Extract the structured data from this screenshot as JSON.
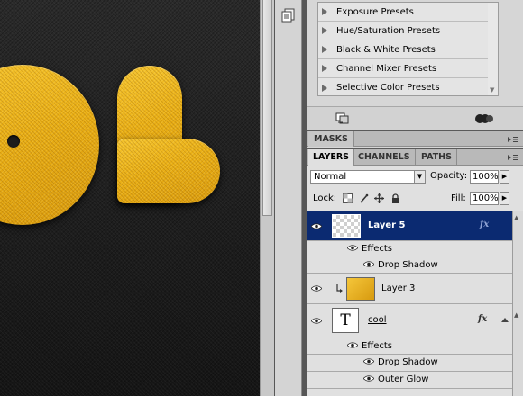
{
  "adjustments": {
    "presets": [
      "Exposure Presets",
      "Hue/Saturation Presets",
      "Black & White Presets",
      "Channel Mixer Presets",
      "Selective Color Presets"
    ],
    "icons": [
      "return-to-list-icon",
      "clip-to-layer-icon"
    ]
  },
  "masks_panel": {
    "tab": "MASKS"
  },
  "layers_panel": {
    "tabs": [
      "LAYERS",
      "CHANNELS",
      "PATHS"
    ],
    "active_tab": "LAYERS",
    "blend_mode": "Normal",
    "opacity_label": "Opacity:",
    "opacity_value": "100%",
    "lock_label": "Lock:",
    "fill_label": "Fill:",
    "fill_value": "100%",
    "layers": [
      {
        "name": "Layer 5",
        "selected": true,
        "fx": "fx",
        "effects_label": "Effects",
        "effects": [
          "Drop Shadow"
        ]
      },
      {
        "name": "Layer 3",
        "selected": false,
        "clipped": true
      },
      {
        "name": "cool",
        "type": "text",
        "thumb_glyph": "T",
        "fx": "fx",
        "effects_label": "Effects",
        "effects": [
          "Drop Shadow",
          "Outer Glow"
        ]
      }
    ]
  },
  "colors": {
    "selection": "#0b2a71",
    "gold": "#e9ae14",
    "canvas_bg": "#1e1e1e",
    "panel_bg": "#d6d6d6"
  }
}
